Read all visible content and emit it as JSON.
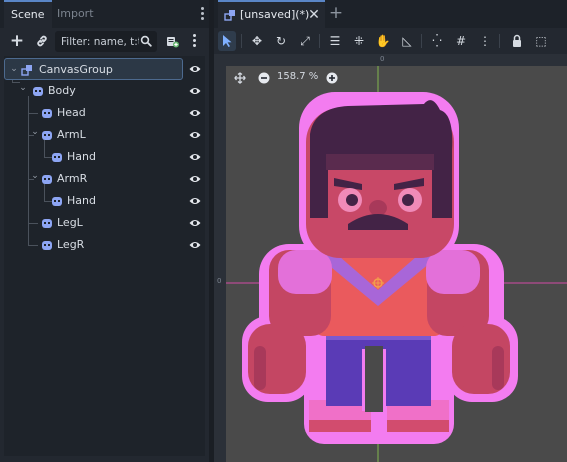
{
  "scene_dock": {
    "tabs": [
      "Scene",
      "Import"
    ],
    "filter_placeholder": "Filter: name, t:ty",
    "tree": [
      {
        "label": "CanvasGroup",
        "level": 0,
        "selected": true,
        "foldable": true
      },
      {
        "label": "Body",
        "level": 1,
        "foldable": true
      },
      {
        "label": "Head",
        "level": 2
      },
      {
        "label": "ArmL",
        "level": 2,
        "foldable": true
      },
      {
        "label": "Hand",
        "level": 3
      },
      {
        "label": "ArmR",
        "level": 2,
        "foldable": true
      },
      {
        "label": "Hand",
        "level": 3
      },
      {
        "label": "LegL",
        "level": 2
      },
      {
        "label": "LegR",
        "level": 2
      }
    ]
  },
  "editor": {
    "tab_title": "[unsaved](*)",
    "zoom_level": "158.7 %",
    "ruler_zero_top": "0",
    "ruler_zero_left": "0"
  },
  "colors": {
    "accent": "#5a86c7",
    "node_icon": "#8da5f3",
    "canvas_group_icon": "#8da5f3",
    "axis_x": "#e04bb0",
    "axis_y": "#8fd14f",
    "outline": "#f37cf0"
  },
  "icons": {
    "add": "plus-icon",
    "link": "link-icon",
    "search": "search-icon",
    "script": "script-add-icon",
    "menu": "kebab-menu-icon",
    "visibility": "eye-icon",
    "close": "close-icon",
    "new_tab": "plus-icon"
  }
}
